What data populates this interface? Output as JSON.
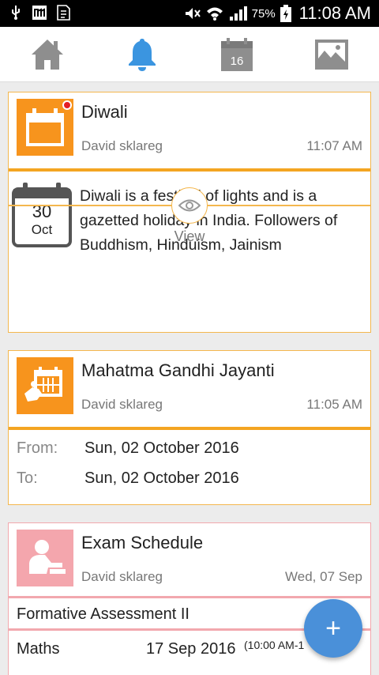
{
  "status_bar": {
    "battery_text": "75%",
    "time": "11:08 AM"
  },
  "nav": {
    "items": [
      {
        "name": "home",
        "icon": "home-icon"
      },
      {
        "name": "notifications",
        "icon": "bell-icon",
        "active": true
      },
      {
        "name": "calendar",
        "icon": "calendar-icon",
        "label": "16"
      },
      {
        "name": "gallery",
        "icon": "image-icon"
      }
    ]
  },
  "colors": {
    "accent_orange": "#f7941d",
    "accent_blue": "#4a90d9",
    "exam_pink": "#f4a6ad"
  },
  "cards": [
    {
      "title": "Diwali",
      "author": "David sklareg",
      "time": "11:07 AM",
      "date_day": "30",
      "date_month": "Oct",
      "description": "Diwali is a festival of lights and is a gazetted holiday in India. Followers of Buddhism, Hinduism, Jainism",
      "view_label": "View"
    },
    {
      "title": "Mahatma Gandhi Jayanti",
      "author": "David sklareg",
      "time": "11:05 AM",
      "from_label": "From:",
      "from_value": "Sun, 02 October 2016",
      "to_label": "To:",
      "to_value": "Sun, 02 October 2016"
    },
    {
      "title": "Exam Schedule",
      "author": "David sklareg",
      "time": "Wed, 07 Sep",
      "subtitle": "Formative Assessment II",
      "rows": [
        {
          "subject": "Maths",
          "date": "17 Sep 2016",
          "time": "(10:00 AM-1"
        }
      ]
    }
  ],
  "fab": {
    "label": "+"
  }
}
